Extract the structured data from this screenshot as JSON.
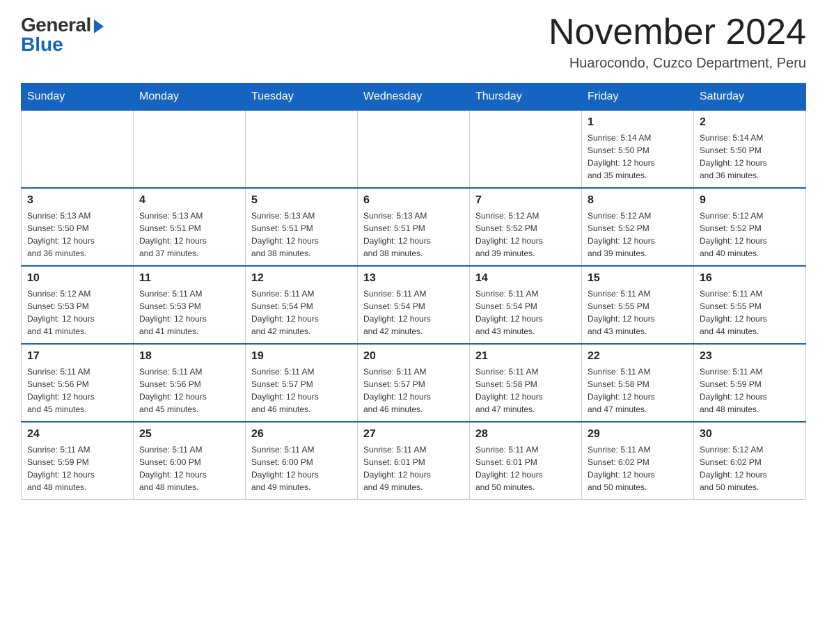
{
  "logo": {
    "general": "General",
    "blue": "Blue"
  },
  "header": {
    "month": "November 2024",
    "location": "Huarocondo, Cuzco Department, Peru"
  },
  "days_of_week": [
    "Sunday",
    "Monday",
    "Tuesday",
    "Wednesday",
    "Thursday",
    "Friday",
    "Saturday"
  ],
  "weeks": [
    [
      {
        "day": "",
        "info": ""
      },
      {
        "day": "",
        "info": ""
      },
      {
        "day": "",
        "info": ""
      },
      {
        "day": "",
        "info": ""
      },
      {
        "day": "",
        "info": ""
      },
      {
        "day": "1",
        "info": "Sunrise: 5:14 AM\nSunset: 5:50 PM\nDaylight: 12 hours\nand 35 minutes."
      },
      {
        "day": "2",
        "info": "Sunrise: 5:14 AM\nSunset: 5:50 PM\nDaylight: 12 hours\nand 36 minutes."
      }
    ],
    [
      {
        "day": "3",
        "info": "Sunrise: 5:13 AM\nSunset: 5:50 PM\nDaylight: 12 hours\nand 36 minutes."
      },
      {
        "day": "4",
        "info": "Sunrise: 5:13 AM\nSunset: 5:51 PM\nDaylight: 12 hours\nand 37 minutes."
      },
      {
        "day": "5",
        "info": "Sunrise: 5:13 AM\nSunset: 5:51 PM\nDaylight: 12 hours\nand 38 minutes."
      },
      {
        "day": "6",
        "info": "Sunrise: 5:13 AM\nSunset: 5:51 PM\nDaylight: 12 hours\nand 38 minutes."
      },
      {
        "day": "7",
        "info": "Sunrise: 5:12 AM\nSunset: 5:52 PM\nDaylight: 12 hours\nand 39 minutes."
      },
      {
        "day": "8",
        "info": "Sunrise: 5:12 AM\nSunset: 5:52 PM\nDaylight: 12 hours\nand 39 minutes."
      },
      {
        "day": "9",
        "info": "Sunrise: 5:12 AM\nSunset: 5:52 PM\nDaylight: 12 hours\nand 40 minutes."
      }
    ],
    [
      {
        "day": "10",
        "info": "Sunrise: 5:12 AM\nSunset: 5:53 PM\nDaylight: 12 hours\nand 41 minutes."
      },
      {
        "day": "11",
        "info": "Sunrise: 5:11 AM\nSunset: 5:53 PM\nDaylight: 12 hours\nand 41 minutes."
      },
      {
        "day": "12",
        "info": "Sunrise: 5:11 AM\nSunset: 5:54 PM\nDaylight: 12 hours\nand 42 minutes."
      },
      {
        "day": "13",
        "info": "Sunrise: 5:11 AM\nSunset: 5:54 PM\nDaylight: 12 hours\nand 42 minutes."
      },
      {
        "day": "14",
        "info": "Sunrise: 5:11 AM\nSunset: 5:54 PM\nDaylight: 12 hours\nand 43 minutes."
      },
      {
        "day": "15",
        "info": "Sunrise: 5:11 AM\nSunset: 5:55 PM\nDaylight: 12 hours\nand 43 minutes."
      },
      {
        "day": "16",
        "info": "Sunrise: 5:11 AM\nSunset: 5:55 PM\nDaylight: 12 hours\nand 44 minutes."
      }
    ],
    [
      {
        "day": "17",
        "info": "Sunrise: 5:11 AM\nSunset: 5:56 PM\nDaylight: 12 hours\nand 45 minutes."
      },
      {
        "day": "18",
        "info": "Sunrise: 5:11 AM\nSunset: 5:56 PM\nDaylight: 12 hours\nand 45 minutes."
      },
      {
        "day": "19",
        "info": "Sunrise: 5:11 AM\nSunset: 5:57 PM\nDaylight: 12 hours\nand 46 minutes."
      },
      {
        "day": "20",
        "info": "Sunrise: 5:11 AM\nSunset: 5:57 PM\nDaylight: 12 hours\nand 46 minutes."
      },
      {
        "day": "21",
        "info": "Sunrise: 5:11 AM\nSunset: 5:58 PM\nDaylight: 12 hours\nand 47 minutes."
      },
      {
        "day": "22",
        "info": "Sunrise: 5:11 AM\nSunset: 5:58 PM\nDaylight: 12 hours\nand 47 minutes."
      },
      {
        "day": "23",
        "info": "Sunrise: 5:11 AM\nSunset: 5:59 PM\nDaylight: 12 hours\nand 48 minutes."
      }
    ],
    [
      {
        "day": "24",
        "info": "Sunrise: 5:11 AM\nSunset: 5:59 PM\nDaylight: 12 hours\nand 48 minutes."
      },
      {
        "day": "25",
        "info": "Sunrise: 5:11 AM\nSunset: 6:00 PM\nDaylight: 12 hours\nand 48 minutes."
      },
      {
        "day": "26",
        "info": "Sunrise: 5:11 AM\nSunset: 6:00 PM\nDaylight: 12 hours\nand 49 minutes."
      },
      {
        "day": "27",
        "info": "Sunrise: 5:11 AM\nSunset: 6:01 PM\nDaylight: 12 hours\nand 49 minutes."
      },
      {
        "day": "28",
        "info": "Sunrise: 5:11 AM\nSunset: 6:01 PM\nDaylight: 12 hours\nand 50 minutes."
      },
      {
        "day": "29",
        "info": "Sunrise: 5:11 AM\nSunset: 6:02 PM\nDaylight: 12 hours\nand 50 minutes."
      },
      {
        "day": "30",
        "info": "Sunrise: 5:12 AM\nSunset: 6:02 PM\nDaylight: 12 hours\nand 50 minutes."
      }
    ]
  ]
}
